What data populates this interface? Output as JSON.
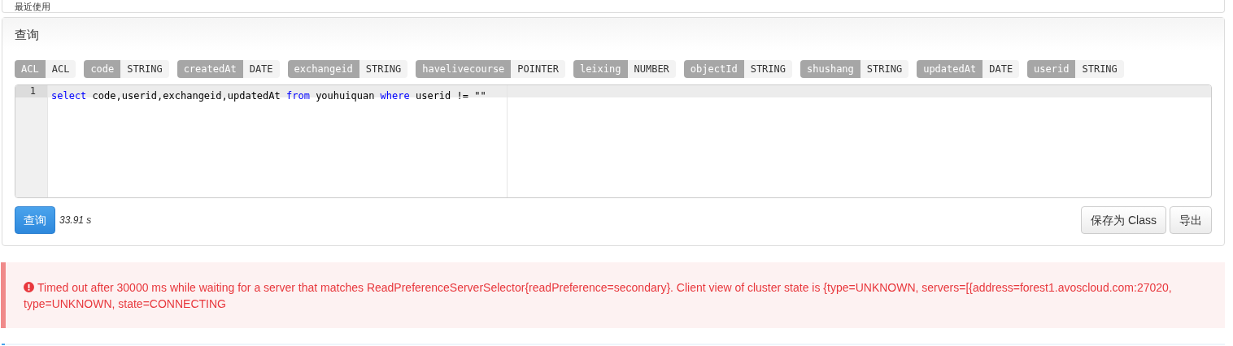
{
  "recent_panel": {
    "title": "最近使用"
  },
  "query_panel": {
    "title": "查询",
    "fields": [
      {
        "name": "ACL",
        "type": "ACL"
      },
      {
        "name": "code",
        "type": "STRING"
      },
      {
        "name": "createdAt",
        "type": "DATE"
      },
      {
        "name": "exchangeid",
        "type": "STRING"
      },
      {
        "name": "havelivecourse",
        "type": "POINTER"
      },
      {
        "name": "leixing",
        "type": "NUMBER"
      },
      {
        "name": "objectId",
        "type": "STRING"
      },
      {
        "name": "shushang",
        "type": "STRING"
      },
      {
        "name": "updatedAt",
        "type": "DATE"
      },
      {
        "name": "userid",
        "type": "STRING"
      }
    ],
    "editor": {
      "lines": [
        {
          "number": "1",
          "tokens": [
            {
              "kind": "keyword",
              "text": "select"
            },
            {
              "kind": "plain",
              "text": " code,userid,exchangeid,updatedAt "
            },
            {
              "kind": "keyword",
              "text": "from"
            },
            {
              "kind": "plain",
              "text": " youhuiquan "
            },
            {
              "kind": "keyword",
              "text": "where"
            },
            {
              "kind": "plain",
              "text": " userid != \"\""
            }
          ]
        }
      ]
    },
    "run_button": "查询",
    "elapsed": "33.91 s",
    "save_button": "保存为 Class",
    "export_button": "导出"
  },
  "error_alert": {
    "message": "Timed out after 30000 ms while waiting for a server that matches ReadPreferenceServerSelector{readPreference=secondary}. Client view of cluster state is {type=UNKNOWN, servers=[{address=forest1.avoscloud.com:27020, type=UNKNOWN, state=CONNECTING"
  }
}
